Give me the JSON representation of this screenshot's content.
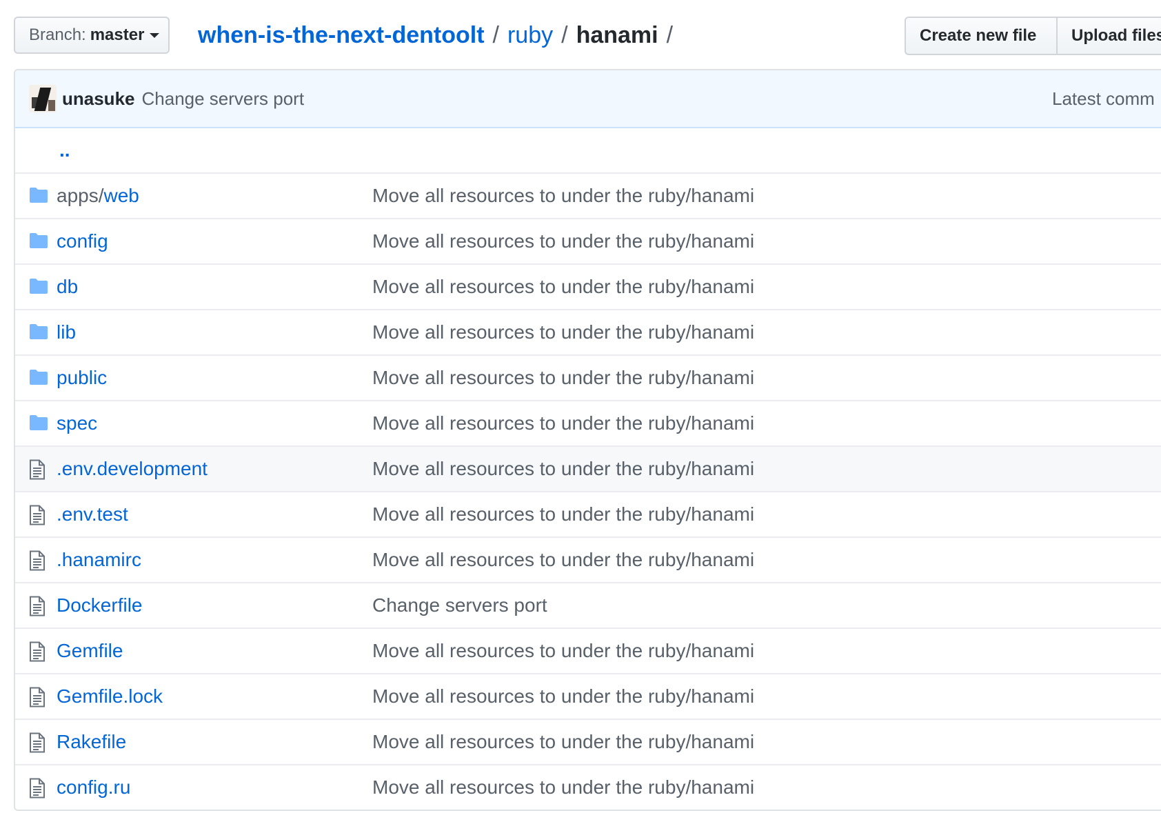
{
  "colors": {
    "link": "#0366d6",
    "muted": "#586069",
    "text": "#24292e",
    "commit_bar_bg": "#f1f8ff",
    "folder_icon": "#79b8ff",
    "file_icon": "#6a737d"
  },
  "branch": {
    "prefix": "Branch:",
    "name": "master"
  },
  "breadcrumb": {
    "repo": "when-is-the-next-dentoolt",
    "dir": "ruby",
    "current": "hanami",
    "separator": "/"
  },
  "actions": {
    "create_new_file": "Create new file",
    "upload_files": "Upload files"
  },
  "commit": {
    "author": "unasuke",
    "message": "Change servers port",
    "latest_label": "Latest comm"
  },
  "parent_link": "..",
  "files": [
    {
      "type": "dir",
      "prefix": "apps/",
      "name": "web",
      "message": "Move all resources to under the ruby/hanami"
    },
    {
      "type": "dir",
      "prefix": "",
      "name": "config",
      "message": "Move all resources to under the ruby/hanami"
    },
    {
      "type": "dir",
      "prefix": "",
      "name": "db",
      "message": "Move all resources to under the ruby/hanami"
    },
    {
      "type": "dir",
      "prefix": "",
      "name": "lib",
      "message": "Move all resources to under the ruby/hanami"
    },
    {
      "type": "dir",
      "prefix": "",
      "name": "public",
      "message": "Move all resources to under the ruby/hanami"
    },
    {
      "type": "dir",
      "prefix": "",
      "name": "spec",
      "message": "Move all resources to under the ruby/hanami"
    },
    {
      "type": "file",
      "prefix": "",
      "name": ".env.development",
      "message": "Move all resources to under the ruby/hanami",
      "highlighted": true
    },
    {
      "type": "file",
      "prefix": "",
      "name": ".env.test",
      "message": "Move all resources to under the ruby/hanami"
    },
    {
      "type": "file",
      "prefix": "",
      "name": ".hanamirc",
      "message": "Move all resources to under the ruby/hanami"
    },
    {
      "type": "file",
      "prefix": "",
      "name": "Dockerfile",
      "message": "Change servers port"
    },
    {
      "type": "file",
      "prefix": "",
      "name": "Gemfile",
      "message": "Move all resources to under the ruby/hanami"
    },
    {
      "type": "file",
      "prefix": "",
      "name": "Gemfile.lock",
      "message": "Move all resources to under the ruby/hanami"
    },
    {
      "type": "file",
      "prefix": "",
      "name": "Rakefile",
      "message": "Move all resources to under the ruby/hanami"
    },
    {
      "type": "file",
      "prefix": "",
      "name": "config.ru",
      "message": "Move all resources to under the ruby/hanami"
    }
  ]
}
